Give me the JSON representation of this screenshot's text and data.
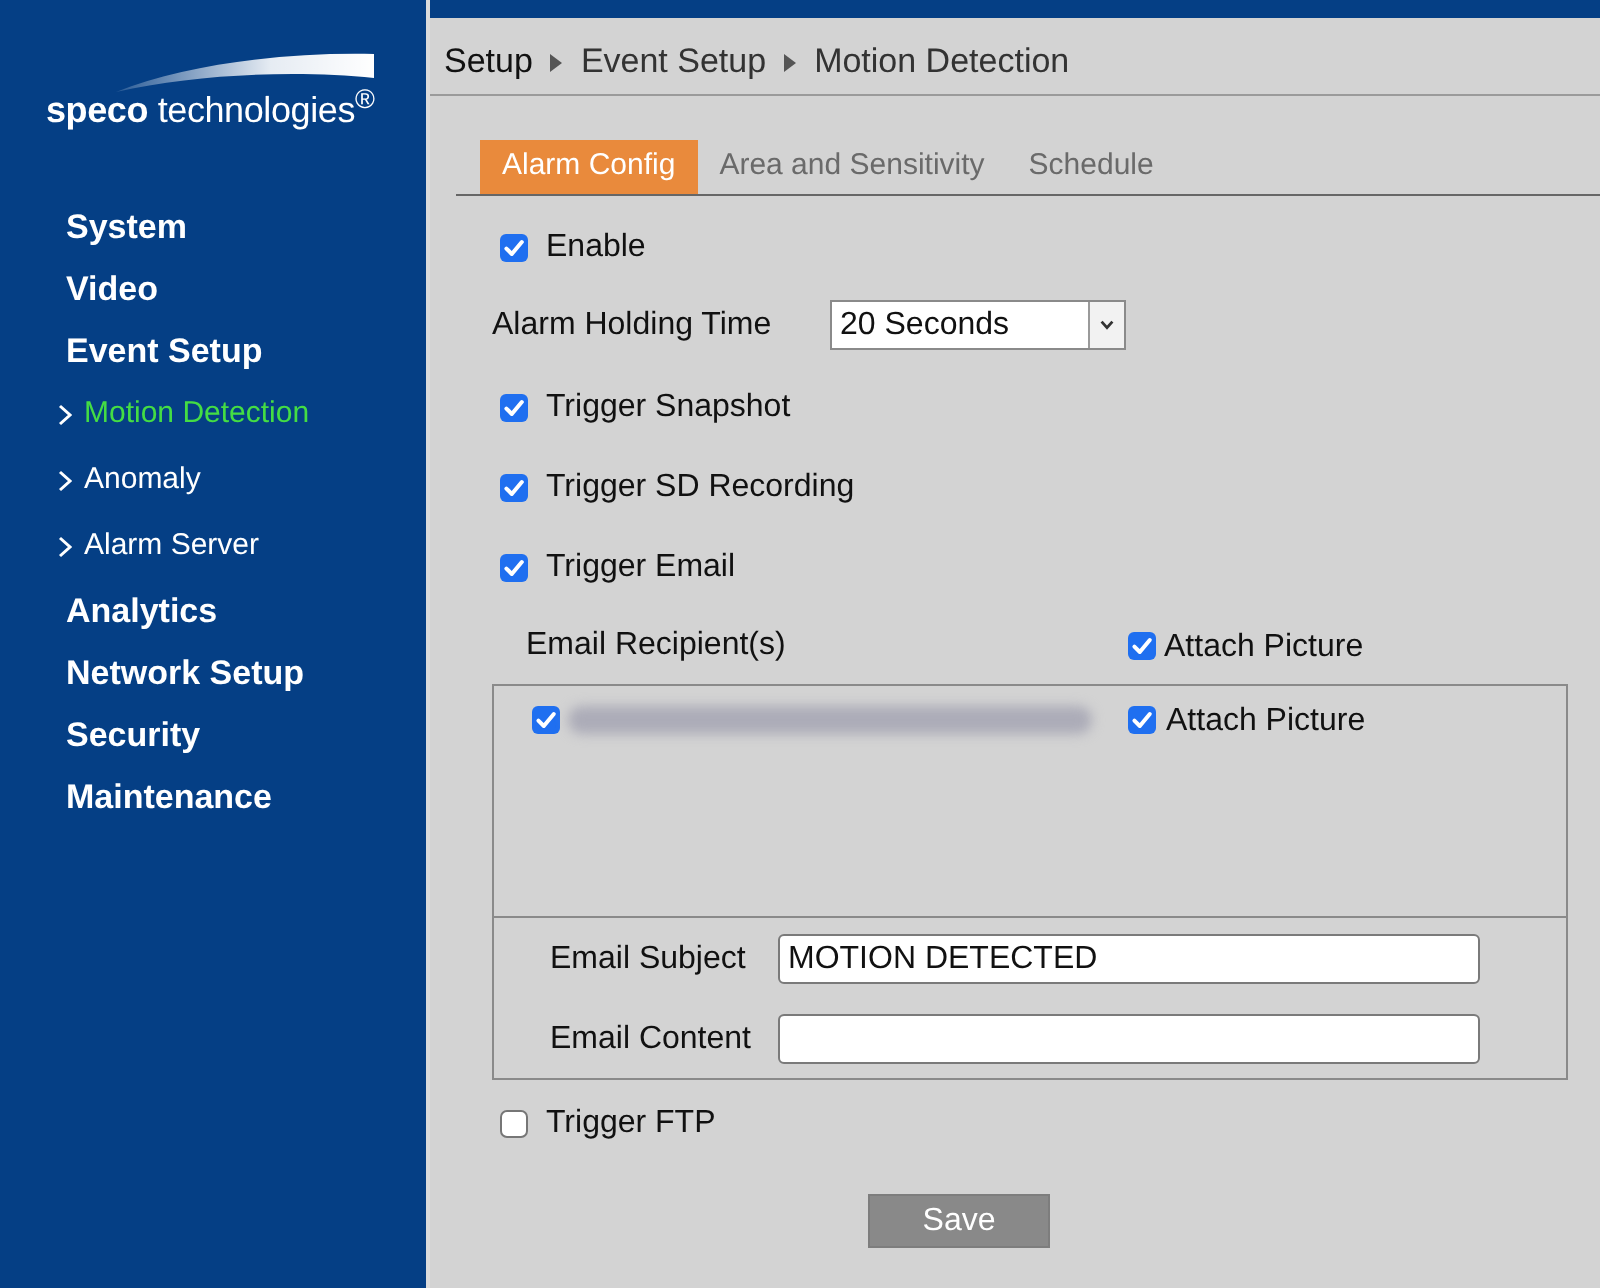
{
  "logo": {
    "text": "**speco** technologies$^{®}$"
  },
  "sidebar": {
    "items": [
      {
        "label": "System",
        "selected": false
      },
      {
        "label": "Video",
        "selected": false
      },
      {
        "label": "Event Setup",
        "selected": false,
        "children": [
          {
            "label": "Motion Detection",
            "selected": true
          },
          {
            "label": "Anomaly",
            "selected": false
          },
          {
            "label": "Alarm Server",
            "selected": false
          }
        ]
      },
      {
        "label": "Analytics",
        "selected": false
      },
      {
        "label": "Network Setup",
        "selected": false
      },
      {
        "label": "Security",
        "selected": false
      },
      {
        "label": "Maintenance",
        "selected": false
      }
    ]
  },
  "breadcrumb": [
    "Setup",
    "Event Setup",
    "Motion Detection"
  ],
  "tabs": [
    {
      "label": "Alarm Config",
      "selected": true
    },
    {
      "label": "Area and Sensitivity",
      "selected": false
    },
    {
      "label": "Schedule",
      "selected": false
    }
  ],
  "form": {
    "enable": {
      "label": "Enable",
      "checked": true
    },
    "holding_time": {
      "label": "Alarm Holding Time",
      "value": "20 Seconds"
    },
    "triggers": [
      {
        "label": "Trigger Snapshot",
        "checked": true
      },
      {
        "label": "Trigger SD Recording",
        "checked": true
      },
      {
        "label": "Trigger Email",
        "checked": true
      }
    ],
    "email": {
      "recipients_label": "Email Recipient(s)",
      "attach_all": {
        "label": "Attach Picture",
        "checked": true
      },
      "recipients": [
        {
          "checked": true,
          "attach_picture": {
            "label": "Attach Picture",
            "checked": true
          }
        }
      ],
      "subject": {
        "label": "Email Subject",
        "value": "MOTION DETECTED"
      },
      "content": {
        "label": "Email Content"
      }
    },
    "ftp": {
      "label": "Trigger FTP",
      "checked": false
    }
  },
  "save_button": "Save"
}
